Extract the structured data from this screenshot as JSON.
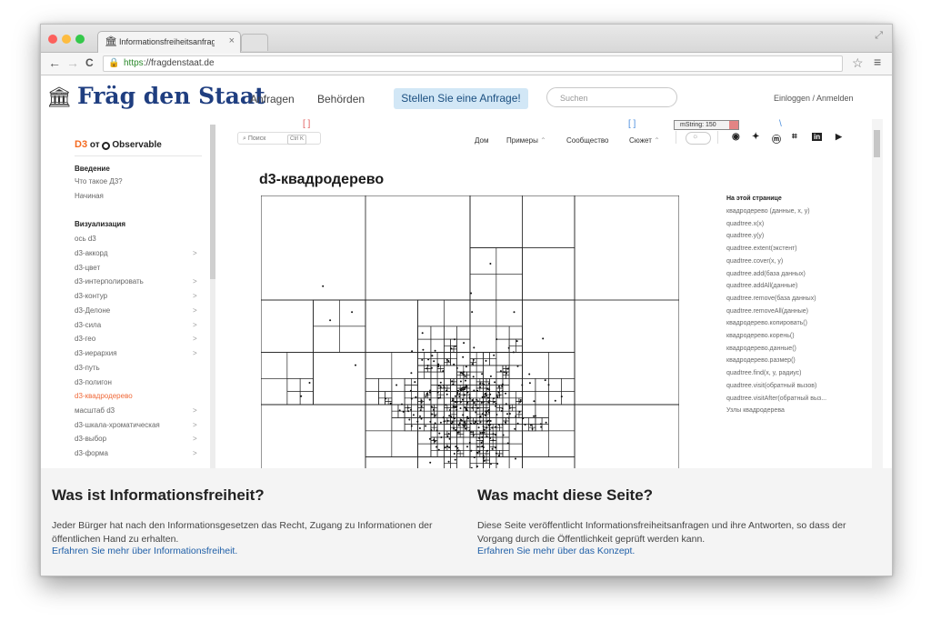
{
  "browser": {
    "tab_title": "Informationsfreiheitsanfrag",
    "tab_close": "×",
    "url_scheme": "https",
    "url_rest": "://fragdenstaat.de",
    "back": "←",
    "forward": "→",
    "reload": "C"
  },
  "site": {
    "logo_text": "Fräg den Staat",
    "nav": [
      "Anfragen",
      "Behörden"
    ],
    "cta": "Stellen Sie eine Anfrage!",
    "search_placeholder": "Suchen",
    "login": "Einloggen / Anmelden"
  },
  "debug": {
    "mstring": "mString: 150",
    "red_mark": "[ ]",
    "blue_mark_1": "[ ]",
    "blue_mark_2": "\\"
  },
  "observable": {
    "brand_from": "от",
    "brand_name": "Observable",
    "search_label": "Поиск",
    "search_kbd": "Ctrl K",
    "topnav": [
      "Дом",
      "Примеры",
      "Сообщество",
      "Сюжет"
    ],
    "sidebar": [
      {
        "type": "section",
        "label": "Введение"
      },
      {
        "type": "item",
        "label": "Что такое Д3?"
      },
      {
        "type": "item",
        "label": "Начиная"
      },
      {
        "type": "section",
        "label": "Визуализация"
      },
      {
        "type": "item",
        "label": "ось d3"
      },
      {
        "type": "item",
        "label": "d3-аккорд",
        "chevron": true
      },
      {
        "type": "item",
        "label": "d3-цвет"
      },
      {
        "type": "item",
        "label": "d3-интерполировать",
        "chevron": true
      },
      {
        "type": "item",
        "label": "d3-контур",
        "chevron": true
      },
      {
        "type": "item",
        "label": "d3-Делоне",
        "chevron": true
      },
      {
        "type": "item",
        "label": "d3-сила",
        "chevron": true
      },
      {
        "type": "item",
        "label": "d3-гео",
        "chevron": true
      },
      {
        "type": "item",
        "label": "d3-иерархия",
        "chevron": true
      },
      {
        "type": "item",
        "label": "d3-путь"
      },
      {
        "type": "item",
        "label": "d3-полигон"
      },
      {
        "type": "item",
        "label": "d3-квадродерево",
        "active": true
      },
      {
        "type": "item",
        "label": "масштаб d3",
        "chevron": true
      },
      {
        "type": "item",
        "label": "d3-шкала-хроматическая",
        "chevron": true
      },
      {
        "type": "item",
        "label": "d3-выбор",
        "chevron": true
      },
      {
        "type": "item",
        "label": "d3-форма",
        "chevron": true
      }
    ],
    "page_title": "d3-квадродерево",
    "toc_title": "На этой странице",
    "toc": [
      "квадродерево (данные, x, y)",
      "quadtree.x(x)",
      "quadtree.y(y)",
      "quadtree.extent(экстент)",
      "quadtree.cover(x, y)",
      "quadtree.add(база данных)",
      "quadtree.addAll(данные)",
      "quadtree.remove(база данных)",
      "quadtree.removeAll(данные)",
      "квадродерево.копировать()",
      "квадродерево.корень()",
      "квадродерево.данные()",
      "квадродерево.размер()",
      "quadtree.find(x, y, радиус)",
      "quadtree.visit(обратный вызов)",
      "quadtree.visitAfter(обратный выз...",
      "Узлы квадродерева"
    ]
  },
  "footer": {
    "left_title": "Was ist Informationsfreiheit?",
    "left_text": "Jeder Bürger hat nach den Informationsgesetzen das Recht, Zugang zu Informationen der öffentlichen Hand zu erhalten.",
    "left_link": "Erfahren Sie mehr über Informationsfreiheit.",
    "right_title": "Was macht diese Seite?",
    "right_text": "Diese Seite veröffentlicht Informationsfreiheitsanfragen und ihre Antworten, so dass der Vorgang durch die Öffentlichkeit geprüft werden kann.",
    "right_link": "Erfahren Sie mehr über das Konzept."
  },
  "colors": {
    "logo": "#1f3e80",
    "cta_bg": "#d2e7f6",
    "active_link": "#f06a3a",
    "footer_link": "#2160a8"
  }
}
